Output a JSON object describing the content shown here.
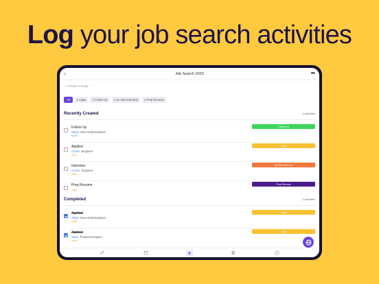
{
  "headline": {
    "bold": "Log",
    "rest": "your job search activities"
  },
  "app": {
    "title": "Job Search 2023",
    "create_activity": "+ Create activity",
    "filters": [
      {
        "label": "All",
        "active": true
      },
      {
        "label": "0  Apply",
        "active": false
      },
      {
        "label": "1  Follow Up",
        "active": false
      },
      {
        "label": "1  On Site Interview",
        "active": false
      },
      {
        "label": "1  Prep Resume",
        "active": false
      }
    ],
    "recently_created": {
      "title": "Recently Created",
      "count": "4 activities",
      "items": [
        {
          "title": "Follow Up",
          "company": "Stripe",
          "role": "New Grad Engineer",
          "tag": "to-fol",
          "status": "Follow Up",
          "status_color": "#3DD65A",
          "tag_color": "blue"
        },
        {
          "title": "Applied",
          "company": "Chase",
          "role": "Engineer",
          "tag": "indie",
          "status": "apply",
          "status_color": "#F8C232",
          "tag_color": "orange"
        },
        {
          "title": "Interview",
          "company": "Cruise",
          "role": "Engineer",
          "tag": "indie",
          "status": "On Site Interview",
          "status_color": "#F07A3C",
          "tag_color": "orange"
        },
        {
          "title": "Prep Resume",
          "company": "",
          "role": "",
          "tag": "indie",
          "status": "Prep Resume",
          "status_color": "#4C1B8C",
          "tag_color": "orange"
        }
      ]
    },
    "completed": {
      "title": "Completed",
      "count": "2 activities",
      "items": [
        {
          "title": "Applied",
          "company": "Stripe",
          "role": "New Grad Engineer",
          "tag": "indie",
          "status": "apply",
          "status_color": "#F8C232"
        },
        {
          "title": "Applied",
          "company": "Slack",
          "role": "Product Designer",
          "tag": "indie",
          "status": "apply",
          "status_color": "#F8C232"
        }
      ]
    }
  },
  "colors": {
    "background": "#FFC940",
    "accent": "#6A45D8",
    "headline": "#1D1446"
  },
  "icons": [
    "back-chevron-icon",
    "more-dots-icon",
    "globe-icon",
    "pencil-icon",
    "calendar-icon",
    "plus-icon",
    "list-icon",
    "help-icon"
  ]
}
